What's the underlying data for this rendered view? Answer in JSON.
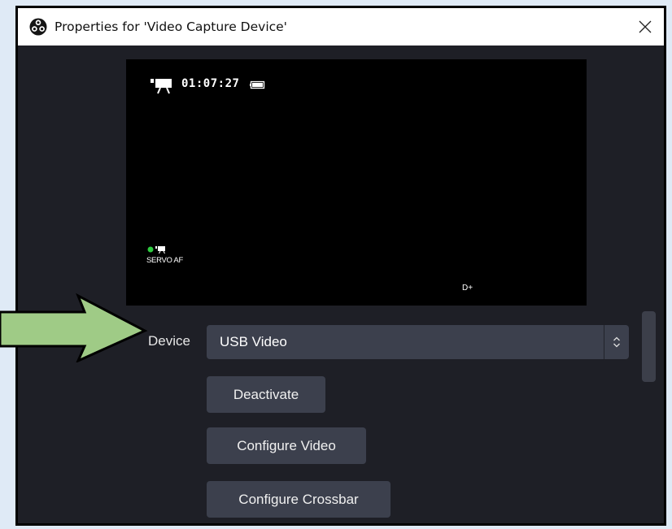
{
  "window": {
    "title": "Properties for 'Video Capture Device'",
    "close_glyph": "✕"
  },
  "preview": {
    "timecode": "01:07:27",
    "focus_mode": "SERVO AF",
    "picture_style": "D+"
  },
  "device": {
    "label": "Device",
    "selected": "USB Video"
  },
  "buttons": {
    "deactivate": "Deactivate",
    "configure_video": "Configure Video",
    "configure_crossbar": "Configure Crossbar"
  },
  "colors": {
    "dialog_bg": "#1e1f26",
    "control_bg": "#3c404d",
    "page_bg": "#dfeaf6",
    "arrow_fill": "#9fcb86",
    "status_dot": "#2ecc40"
  },
  "icons": {
    "app": "obs-logo-icon",
    "close": "close-icon",
    "recording": "movie-camera-icon",
    "battery": "battery-icon",
    "select": "up-down-chevron-icon",
    "annotation": "green-arrow-icon"
  }
}
